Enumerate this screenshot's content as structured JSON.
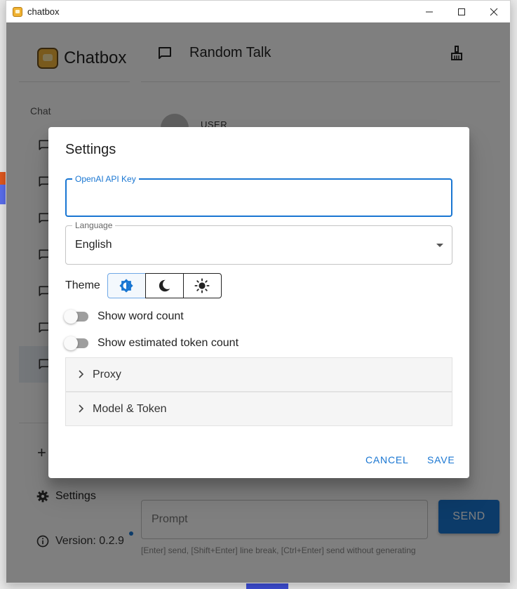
{
  "window": {
    "title": "chatbox",
    "controls": {
      "minimize": "—",
      "maximize": "☐",
      "close": "✕"
    }
  },
  "sidebar": {
    "brand": "Chatbox",
    "section_label": "Chat",
    "settings_label": "Settings",
    "version_label": "Version: 0.2.9",
    "new_chat_label": "+"
  },
  "main": {
    "chat_title": "Random Talk",
    "user_label": "USER",
    "prompt_placeholder": "Prompt",
    "send_label": "SEND",
    "hint": "[Enter] send, [Shift+Enter] line break, [Ctrl+Enter] send without generating"
  },
  "dialog": {
    "title": "Settings",
    "api_key": {
      "label": "OpenAI API Key",
      "value": ""
    },
    "language": {
      "label": "Language",
      "value": "English"
    },
    "theme": {
      "label": "Theme",
      "selected": "system",
      "options": [
        "system-icon",
        "moon-icon",
        "sun-icon"
      ]
    },
    "toggles": [
      {
        "label": "Show word count",
        "on": false
      },
      {
        "label": "Show estimated token count",
        "on": false
      }
    ],
    "sections": [
      {
        "label": "Proxy"
      },
      {
        "label": "Model & Token"
      }
    ],
    "cancel_label": "CANCEL",
    "save_label": "SAVE"
  },
  "colors": {
    "accent": "#1976d2",
    "overlay": "rgba(0,0,0,0.5)"
  }
}
